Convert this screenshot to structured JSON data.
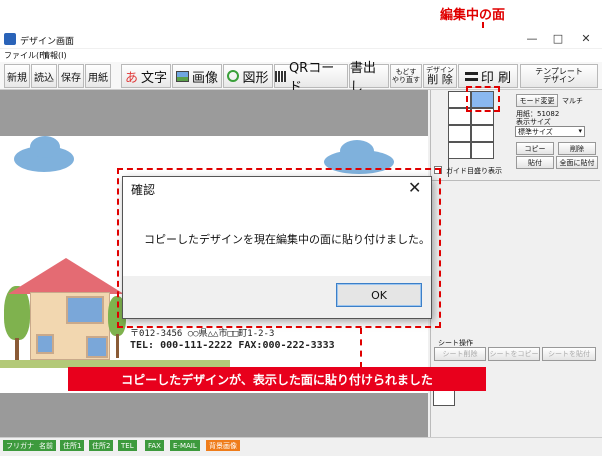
{
  "annotation_top": "編集中の面",
  "annotation_bottom": "コピーしたデザインが、表示した面に貼り付けられました",
  "window": {
    "title": "デザイン画面",
    "minimize": "—",
    "maximize": "□",
    "close": "✕"
  },
  "menu": [
    "ファイル(F)",
    "情報(I)"
  ],
  "toolbar": {
    "new": "新規",
    "load": "読込",
    "save": "保存",
    "paper": "用紙",
    "text_glyph": "あ",
    "text": "文字",
    "image": "画像",
    "shape": "図形",
    "qr": "QRコード",
    "write": "書出し",
    "undo_line1": "もどす",
    "undo_line2": "やり直す",
    "delete_line1": "デザイン",
    "delete_line2": "削 除",
    "print": "印 刷",
    "template_line1": "テンプレート",
    "template_line2": "デザイン"
  },
  "right_panel": {
    "mode_change": "モード変更",
    "multi": "マルチ",
    "paper_label": "用紙：51082",
    "display_size_label": "表示サイズ",
    "display_size_value": "標準サイズ",
    "copy": "コピー",
    "delete": "削除",
    "paste": "貼付",
    "paste_all": "全面に貼付",
    "guide_display": "ガイド目盛り表示",
    "sheet_ops": "シート操作",
    "sheet_delete": "シート削除",
    "sheet_copy": "シートをコピー",
    "sheet_paste": "シートを貼付"
  },
  "card": {
    "address_line": "〒012-3456 ○○県△△市□□町1-2-3",
    "tel_fax_line": "TEL: 000-111-2222 FAX:000-222-3333"
  },
  "dialog": {
    "title": "確認",
    "close": "✕",
    "message": "コピーしたデザインを現在編集中の面に貼り付けました。",
    "ok": "OK"
  },
  "status_tags": [
    "フリガナ",
    "名前",
    "住所1",
    "住所2",
    "TEL",
    "FAX",
    "E-MAIL",
    "背景画像"
  ],
  "colors": {
    "accent_red": "#e00000",
    "caption_bg": "#e8001c",
    "selected_cell": "#8ab8f0",
    "tag_green": "#3d9a3d",
    "tag_orange": "#ef7c1a"
  }
}
